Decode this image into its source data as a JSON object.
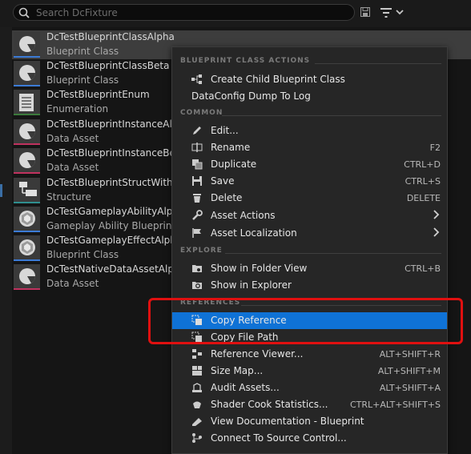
{
  "search": {
    "placeholder": "Search DcFixture"
  },
  "assets": [
    {
      "name": "DcTestBlueprintClassAlpha",
      "type": "Blueprint Class",
      "color": "#3c7bd6",
      "icon": "blueprint-class-icon",
      "selected": true
    },
    {
      "name": "DcTestBlueprintClassBeta",
      "type": "Blueprint Class",
      "color": "#3c7bd6",
      "icon": "blueprint-class-icon"
    },
    {
      "name": "DcTestBlueprintEnum",
      "type": "Enumeration",
      "color": "#3b7a3b",
      "icon": "enumeration-icon"
    },
    {
      "name": "DcTestBlueprintInstanceAlpha",
      "type": "Data Asset",
      "color": "#c0325f",
      "icon": "data-asset-icon"
    },
    {
      "name": "DcTestBlueprintInstanceBeta",
      "type": "Data Asset",
      "color": "#c0325f",
      "icon": "data-asset-icon"
    },
    {
      "name": "DcTestBlueprintStructWithCo",
      "type": "Structure",
      "color": "#2f8f8f",
      "icon": "structure-icon"
    },
    {
      "name": "DcTestGameplayAbilityAlpha",
      "type": "Gameplay Ability Blueprint",
      "color": "#3c7bd6",
      "icon": "gameplay-ability-icon"
    },
    {
      "name": "DcTestGameplayEffectAlpha",
      "type": "Blueprint Class",
      "color": "#3c7bd6",
      "icon": "gameplay-effect-icon"
    },
    {
      "name": "DcTestNativeDataAssetAlpha",
      "type": "Data Asset",
      "color": "#c0325f",
      "icon": "data-asset-icon"
    }
  ],
  "menu": {
    "sections": {
      "blueprint": "BLUEPRINT CLASS ACTIONS",
      "common": "COMMON",
      "explore": "EXPLORE",
      "references": "REFERENCES"
    },
    "items": [
      {
        "label": "Create Child Blueprint Class",
        "shortcut": "",
        "icon": "create-child-icon"
      },
      {
        "label": "DataConfig Dump To Log",
        "shortcut": "",
        "icon": ""
      },
      {
        "label": "Edit...",
        "shortcut": "",
        "icon": "edit-icon"
      },
      {
        "label": "Rename",
        "shortcut": "F2",
        "icon": "rename-icon"
      },
      {
        "label": "Duplicate",
        "shortcut": "CTRL+D",
        "icon": "duplicate-icon"
      },
      {
        "label": "Save",
        "shortcut": "CTRL+S",
        "icon": "save-icon"
      },
      {
        "label": "Delete",
        "shortcut": "DELETE",
        "icon": "delete-icon"
      },
      {
        "label": "Asset Actions",
        "shortcut": "",
        "icon": "wrench-icon",
        "submenu": true
      },
      {
        "label": "Asset Localization",
        "shortcut": "",
        "icon": "flag-icon",
        "submenu": true
      },
      {
        "label": "Show in Folder View",
        "shortcut": "CTRL+B",
        "icon": "folder-view-icon"
      },
      {
        "label": "Show in Explorer",
        "shortcut": "",
        "icon": "explorer-icon"
      },
      {
        "label": "Copy Reference",
        "shortcut": "",
        "icon": "copy-reference-icon",
        "highlighted": true
      },
      {
        "label": "Copy File Path",
        "shortcut": "",
        "icon": "copy-path-icon"
      },
      {
        "label": "Reference Viewer...",
        "shortcut": "ALT+SHIFT+R",
        "icon": "reference-viewer-icon"
      },
      {
        "label": "Size Map...",
        "shortcut": "ALT+SHIFT+M",
        "icon": "size-map-icon"
      },
      {
        "label": "Audit Assets...",
        "shortcut": "ALT+SHIFT+A",
        "icon": "audit-icon"
      },
      {
        "label": "Shader Cook Statistics...",
        "shortcut": "CTRL+ALT+SHIFT+S",
        "icon": "shader-icon"
      },
      {
        "label": "View Documentation - Blueprint",
        "shortcut": "",
        "icon": "documentation-icon"
      },
      {
        "label": "Connect To Source Control...",
        "shortcut": "",
        "icon": "source-control-icon"
      }
    ]
  }
}
